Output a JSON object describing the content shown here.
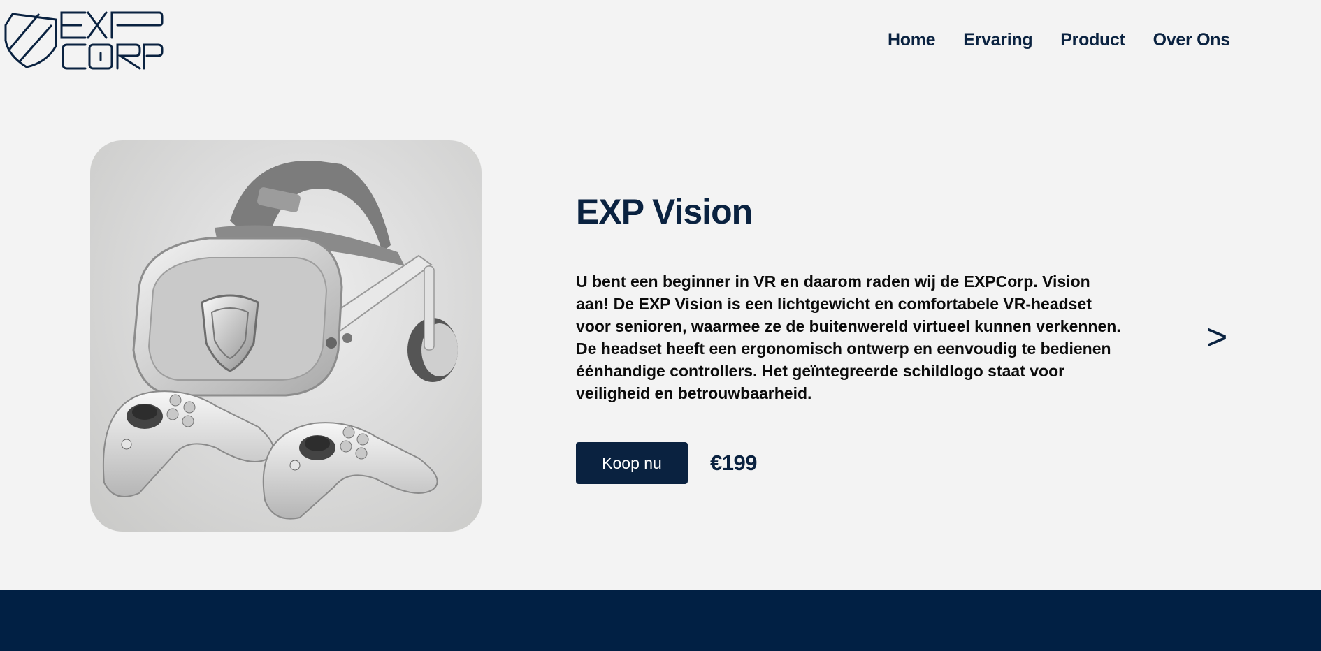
{
  "nav": {
    "items": [
      {
        "label": "Home"
      },
      {
        "label": "Ervaring"
      },
      {
        "label": "Product"
      },
      {
        "label": "Over Ons"
      }
    ]
  },
  "logo": {
    "line1": "EXP",
    "line2": "CORP"
  },
  "product": {
    "title": "EXP Vision",
    "description": "U bent een beginner in VR en daarom raden wij de EXPCorp. Vision aan! De EXP Vision is een lichtgewicht en comfortabele VR-headset voor senioren, waarmee ze de buitenwereld virtueel kunnen verkennen. De headset heeft een ergonomisch ontwerp en eenvoudig te bedienen éénhandige controllers. Het geïntegreerde schildlogo staat voor veiligheid en betrouwbaarheid.",
    "buy_label": "Koop nu",
    "price": "€199",
    "next_arrow": ">"
  },
  "colors": {
    "brand": "#0a2240",
    "background": "#f3f3f3",
    "footer": "#012044"
  },
  "icons": {
    "logo": "shield-logo-icon",
    "next": "chevron-right-icon"
  }
}
